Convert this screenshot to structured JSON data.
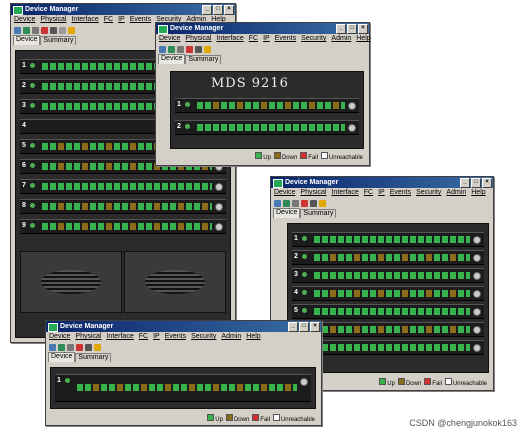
{
  "window_title": "Device Manager",
  "menu": [
    "Device",
    "Physical",
    "Interface",
    "FC",
    "IP",
    "Events",
    "Security",
    "Admin",
    "Help"
  ],
  "tabs": [
    "Device",
    "Summary"
  ],
  "model": "MDS 9216",
  "legend": {
    "up": "Up",
    "down": "Down",
    "fail": "Fail",
    "unreachable": "Unreachable"
  },
  "colors": {
    "up": "#37b24d",
    "down": "#8a6d1a",
    "fail": "#d32f2f",
    "unreachable": "#ffffff",
    "title_bar": "#0a246a"
  },
  "slot_numbers": [
    "1",
    "2",
    "3",
    "4",
    "5",
    "6",
    "7",
    "8",
    "9"
  ],
  "watermark": "CSDN @chengjunokok163"
}
